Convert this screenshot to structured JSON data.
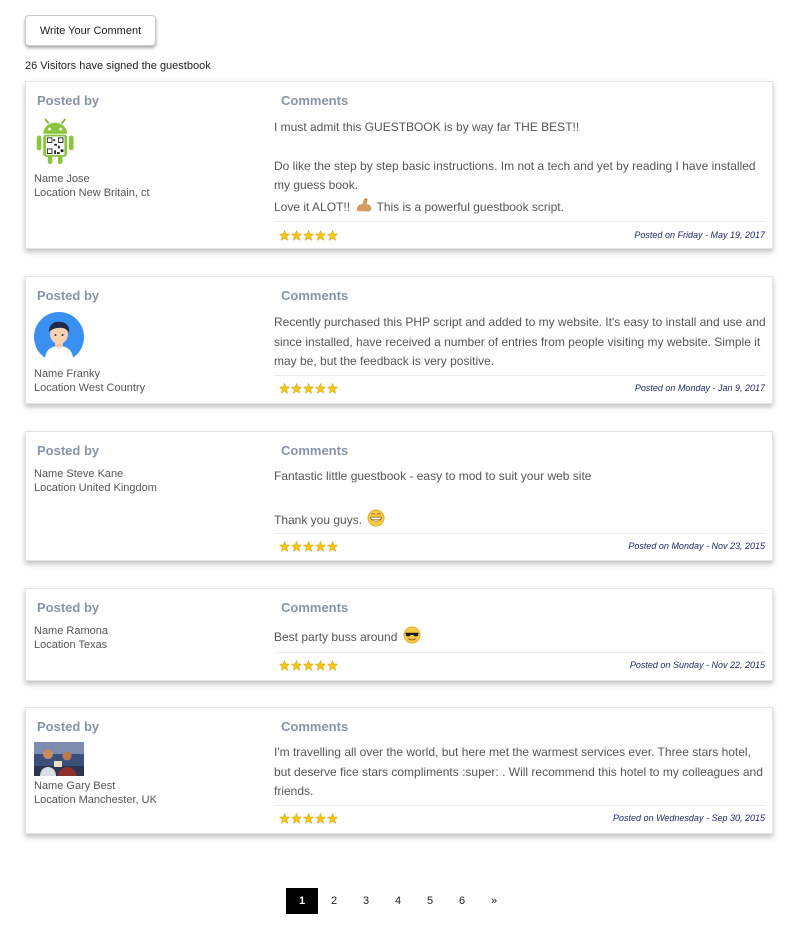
{
  "header": {
    "write_button": "Write Your Comment",
    "visitor_count": "26 Visitors have signed the guestbook"
  },
  "labels": {
    "posted_by": "Posted by",
    "comments": "Comments"
  },
  "entries": [
    {
      "name": "Name Jose",
      "location": "Location New Britain, ct",
      "avatar": "android-qr-avatar",
      "rating": 5,
      "lines": [
        "I must admit this GUESTBOOK is by way far THE BEST!!",
        "Do like the step by step basic instructions. Im not a tech and yet by reading I have installed my guess book.",
        "Love it ALOT!!",
        "This is a powerful guestbook script."
      ],
      "posted_on": "Posted on Friday - May 19, 2017"
    },
    {
      "name": "Name Franky",
      "location": "Location West Country",
      "avatar": "person-avatar",
      "rating": 5,
      "lines": [
        "Recently purchased this PHP script and added to my website. It's easy to install and use and since installed, have received a number of entries from people visiting my website. Simple it may be, but the feedback is very positive."
      ],
      "posted_on": "Posted on Monday - Jan 9, 2017"
    },
    {
      "name": "Name Steve Kane",
      "location": "Location United Kingdom",
      "rating": 5,
      "lines": [
        "Fantastic little guestbook - easy to mod to suit your web site",
        "Thank you guys."
      ],
      "posted_on": "Posted on Monday - Nov 23, 2015"
    },
    {
      "name": "Name Ramona",
      "location": "Location Texas",
      "rating": 5,
      "lines": [
        "Best party buss around"
      ],
      "posted_on": "Posted on Sunday - Nov 22, 2015"
    },
    {
      "name": "Name Gary Best",
      "location": "Location Manchester, UK",
      "avatar": "photo-avatar",
      "rating": 5,
      "lines": [
        "I'm travelling all over the world, but here met the warmest services ever. Three stars hotel, but deserve fice stars compliments :super: . Will recommend this hotel to my colleagues and friends."
      ],
      "posted_on": "Posted on Wednesday - Sep 30, 2015"
    }
  ],
  "pagination": {
    "pages": [
      "1",
      "2",
      "3",
      "4",
      "5",
      "6"
    ],
    "next": "»",
    "current": "1"
  },
  "colors": {
    "heading": "#8794a6",
    "date": "#1f2a66",
    "star": "#f5c518",
    "active_page": "#000000"
  }
}
